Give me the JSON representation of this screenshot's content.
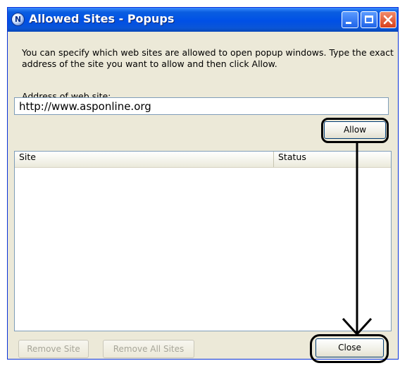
{
  "window": {
    "title": "Allowed Sites - Popups",
    "app_icon_letter": "N"
  },
  "description": "You can specify which web sites are allowed to open popup windows. Type the exact address of the site you want to allow and then click Allow.",
  "address": {
    "label": "Address of web site:",
    "value": "http://www.asponline.org"
  },
  "buttons": {
    "allow": "Allow",
    "remove_site": "Remove Site",
    "remove_all_sites": "Remove All Sites",
    "close": "Close"
  },
  "table": {
    "columns": [
      "Site",
      "Status"
    ],
    "rows": []
  },
  "colors": {
    "titlebar": "#0050e6",
    "window_bg": "#ece9d8",
    "close_button": "#d8401c"
  },
  "icons": [
    "minimize-icon",
    "maximize-icon",
    "close-icon",
    "app-icon"
  ]
}
